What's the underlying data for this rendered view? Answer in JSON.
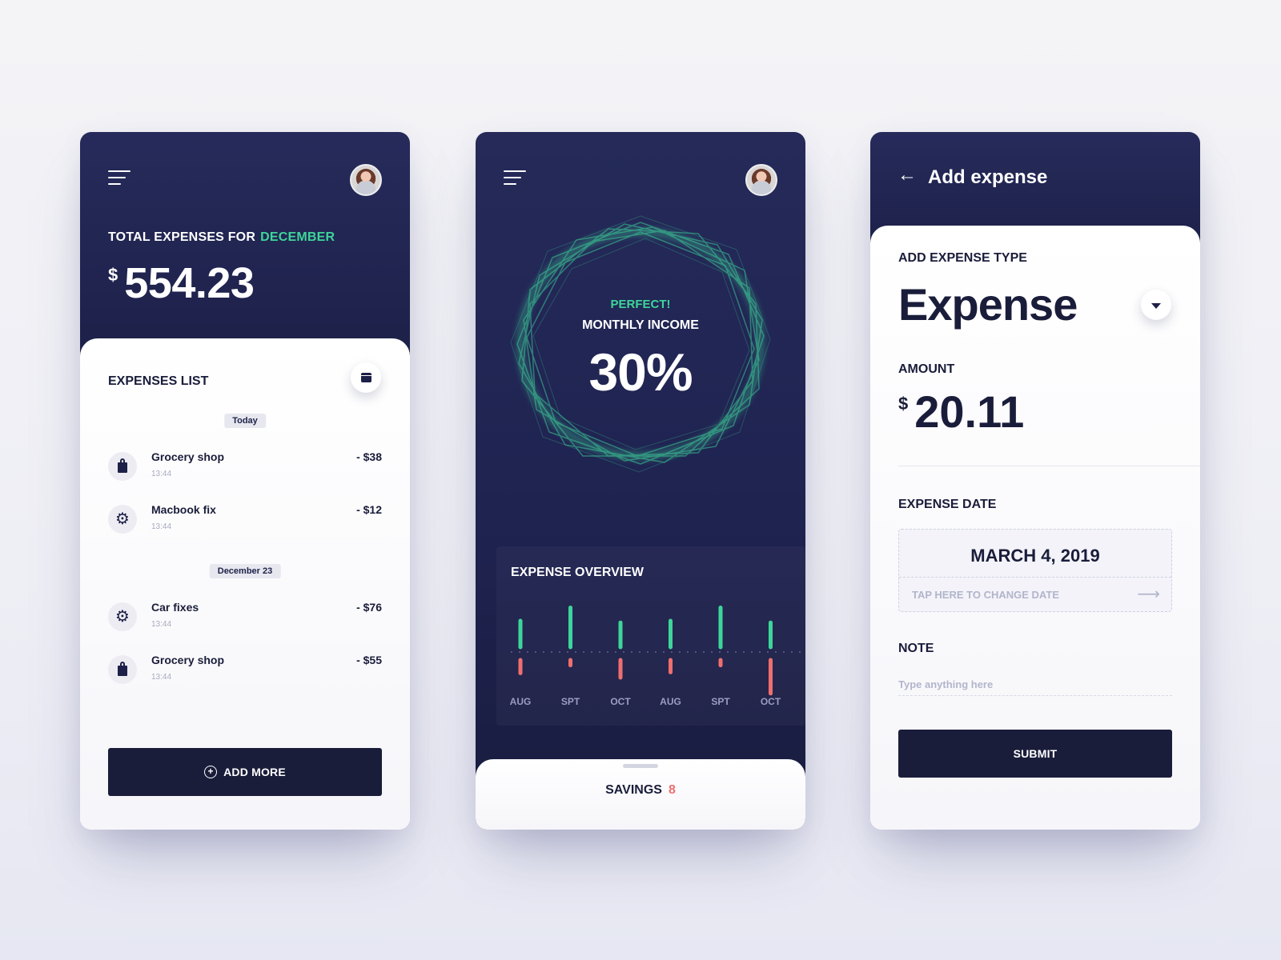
{
  "screen1": {
    "total_label": "TOTAL EXPENSES FOR",
    "total_month": "DECEMBER",
    "currency": "$",
    "total_amount": "554.23",
    "list_title": "EXPENSES LIST",
    "groups": [
      {
        "date": "Today",
        "items": [
          {
            "name": "Grocery shop",
            "time": "13:44",
            "amount": "- $38",
            "icon": "shopping-bag-icon"
          },
          {
            "name": "Macbook fix",
            "time": "13:44",
            "amount": "- $12",
            "icon": "gear-icon"
          }
        ]
      },
      {
        "date": "December 23",
        "items": [
          {
            "name": "Car fixes",
            "time": "13:44",
            "amount": "- $76",
            "icon": "gear-icon"
          },
          {
            "name": "Grocery shop",
            "time": "13:44",
            "amount": "- $55",
            "icon": "shopping-bag-icon"
          }
        ]
      }
    ],
    "add_more_label": "ADD MORE"
  },
  "screen2": {
    "status": "PERFECT!",
    "metric_label": "MONTHLY INCOME",
    "percent": "30%",
    "overview_title": "EXPENSE OVERVIEW",
    "savings_label": "SAVINGS",
    "savings_count": "8"
  },
  "chart_data": {
    "type": "bar",
    "categories": [
      "AUG",
      "SPT",
      "OCT",
      "AUG",
      "SPT",
      "OCT"
    ],
    "series": [
      {
        "values": [
          3,
          4.5,
          2.8,
          3,
          4.5,
          2.8
        ],
        "color": "#3ed59a"
      },
      {
        "values": [
          -1.5,
          -0.6,
          -2,
          -1.4,
          -0.6,
          -3.8
        ],
        "color": "#ef6f6f"
      }
    ],
    "ylim": [
      -4,
      5
    ],
    "grid": false
  },
  "screen3": {
    "title": "Add expense",
    "type_label": "ADD EXPENSE TYPE",
    "type_value": "Expense",
    "amount_label": "AMOUNT",
    "currency": "$",
    "amount": "20.11",
    "date_label": "EXPENSE DATE",
    "date_value": "MARCH 4, 2019",
    "date_hint": "TAP HERE TO CHANGE DATE",
    "note_label": "NOTE",
    "note_placeholder": "Type anything here",
    "submit_label": "SUBMIT"
  },
  "colors": {
    "navy": "#1d2048",
    "accent_green": "#3ed59a",
    "accent_red": "#ef6f6f"
  }
}
